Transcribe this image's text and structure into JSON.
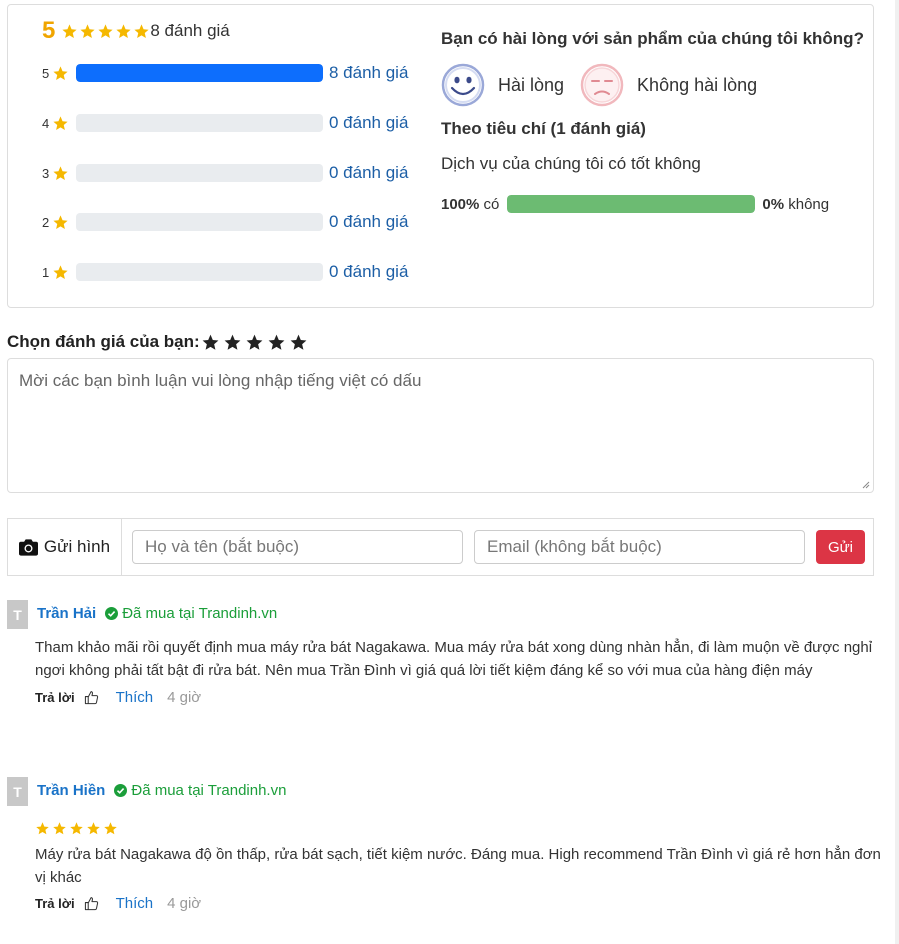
{
  "summary": {
    "average": "5",
    "total_label": "8 đánh giá",
    "star_color": "#f5b800",
    "bars": [
      {
        "stars": "5",
        "percent": 100,
        "label": "8 đánh giá"
      },
      {
        "stars": "4",
        "percent": 0,
        "label": "0 đánh giá"
      },
      {
        "stars": "3",
        "percent": 0,
        "label": "0 đánh giá"
      },
      {
        "stars": "2",
        "percent": 0,
        "label": "0 đánh giá"
      },
      {
        "stars": "1",
        "percent": 0,
        "label": "0 đánh giá"
      }
    ]
  },
  "satisfaction": {
    "question": "Bạn có hài lòng với sản phẩm của chúng tôi không?",
    "satisfied_label": "Hài lòng",
    "unsatisfied_label": "Không hài lòng",
    "criteria_title": "Theo tiêu chí (1 đánh giá)",
    "criteria_question": "Dịch vụ của chúng tôi có tốt không",
    "yes_percent": "100%",
    "yes_label": "có",
    "no_percent": "0%",
    "no_label": "không",
    "yes_fill": 1.0
  },
  "review_form": {
    "choose_label": "Chọn đánh giá của bạn:",
    "choose_stars": 5,
    "comment_placeholder": "Mời các bạn bình luận vui lòng nhập tiếng việt có dấu",
    "upload_label": "Gửi hình",
    "name_placeholder": "Họ và tên (bắt buộc)",
    "email_placeholder": "Email (không bắt buộc)",
    "send_label": "Gửi"
  },
  "reviews": [
    {
      "avatar": "T",
      "name": "Trần Hải",
      "verified": "Đã mua tại Trandinh.vn",
      "stars": 0,
      "text": "Tham khảo mãi rồi quyết định mua máy rửa bát Nagakawa. Mua máy rửa bát xong dùng nhàn hẳn, đi làm muộn về được nghỉ ngơi không phải tất bật đi rửa bát. Nên mua Trần Đình vì giá quá lời tiết kiệm đáng kể so với mua của hàng điện máy",
      "reply": "Trả lời",
      "like": "Thích",
      "time": "4 giờ"
    },
    {
      "avatar": "T",
      "name": "Trần Hiền",
      "verified": "Đã mua tại Trandinh.vn",
      "stars": 5,
      "text": "Máy rửa bát Nagakawa độ ồn thấp, rửa bát sạch, tiết kiệm nước. Đáng mua. High recommend Trần Đình vì giá rẻ hơn hẳn đơn vị khác",
      "reply": "Trả lời",
      "like": "Thích",
      "time": "4 giờ"
    }
  ]
}
